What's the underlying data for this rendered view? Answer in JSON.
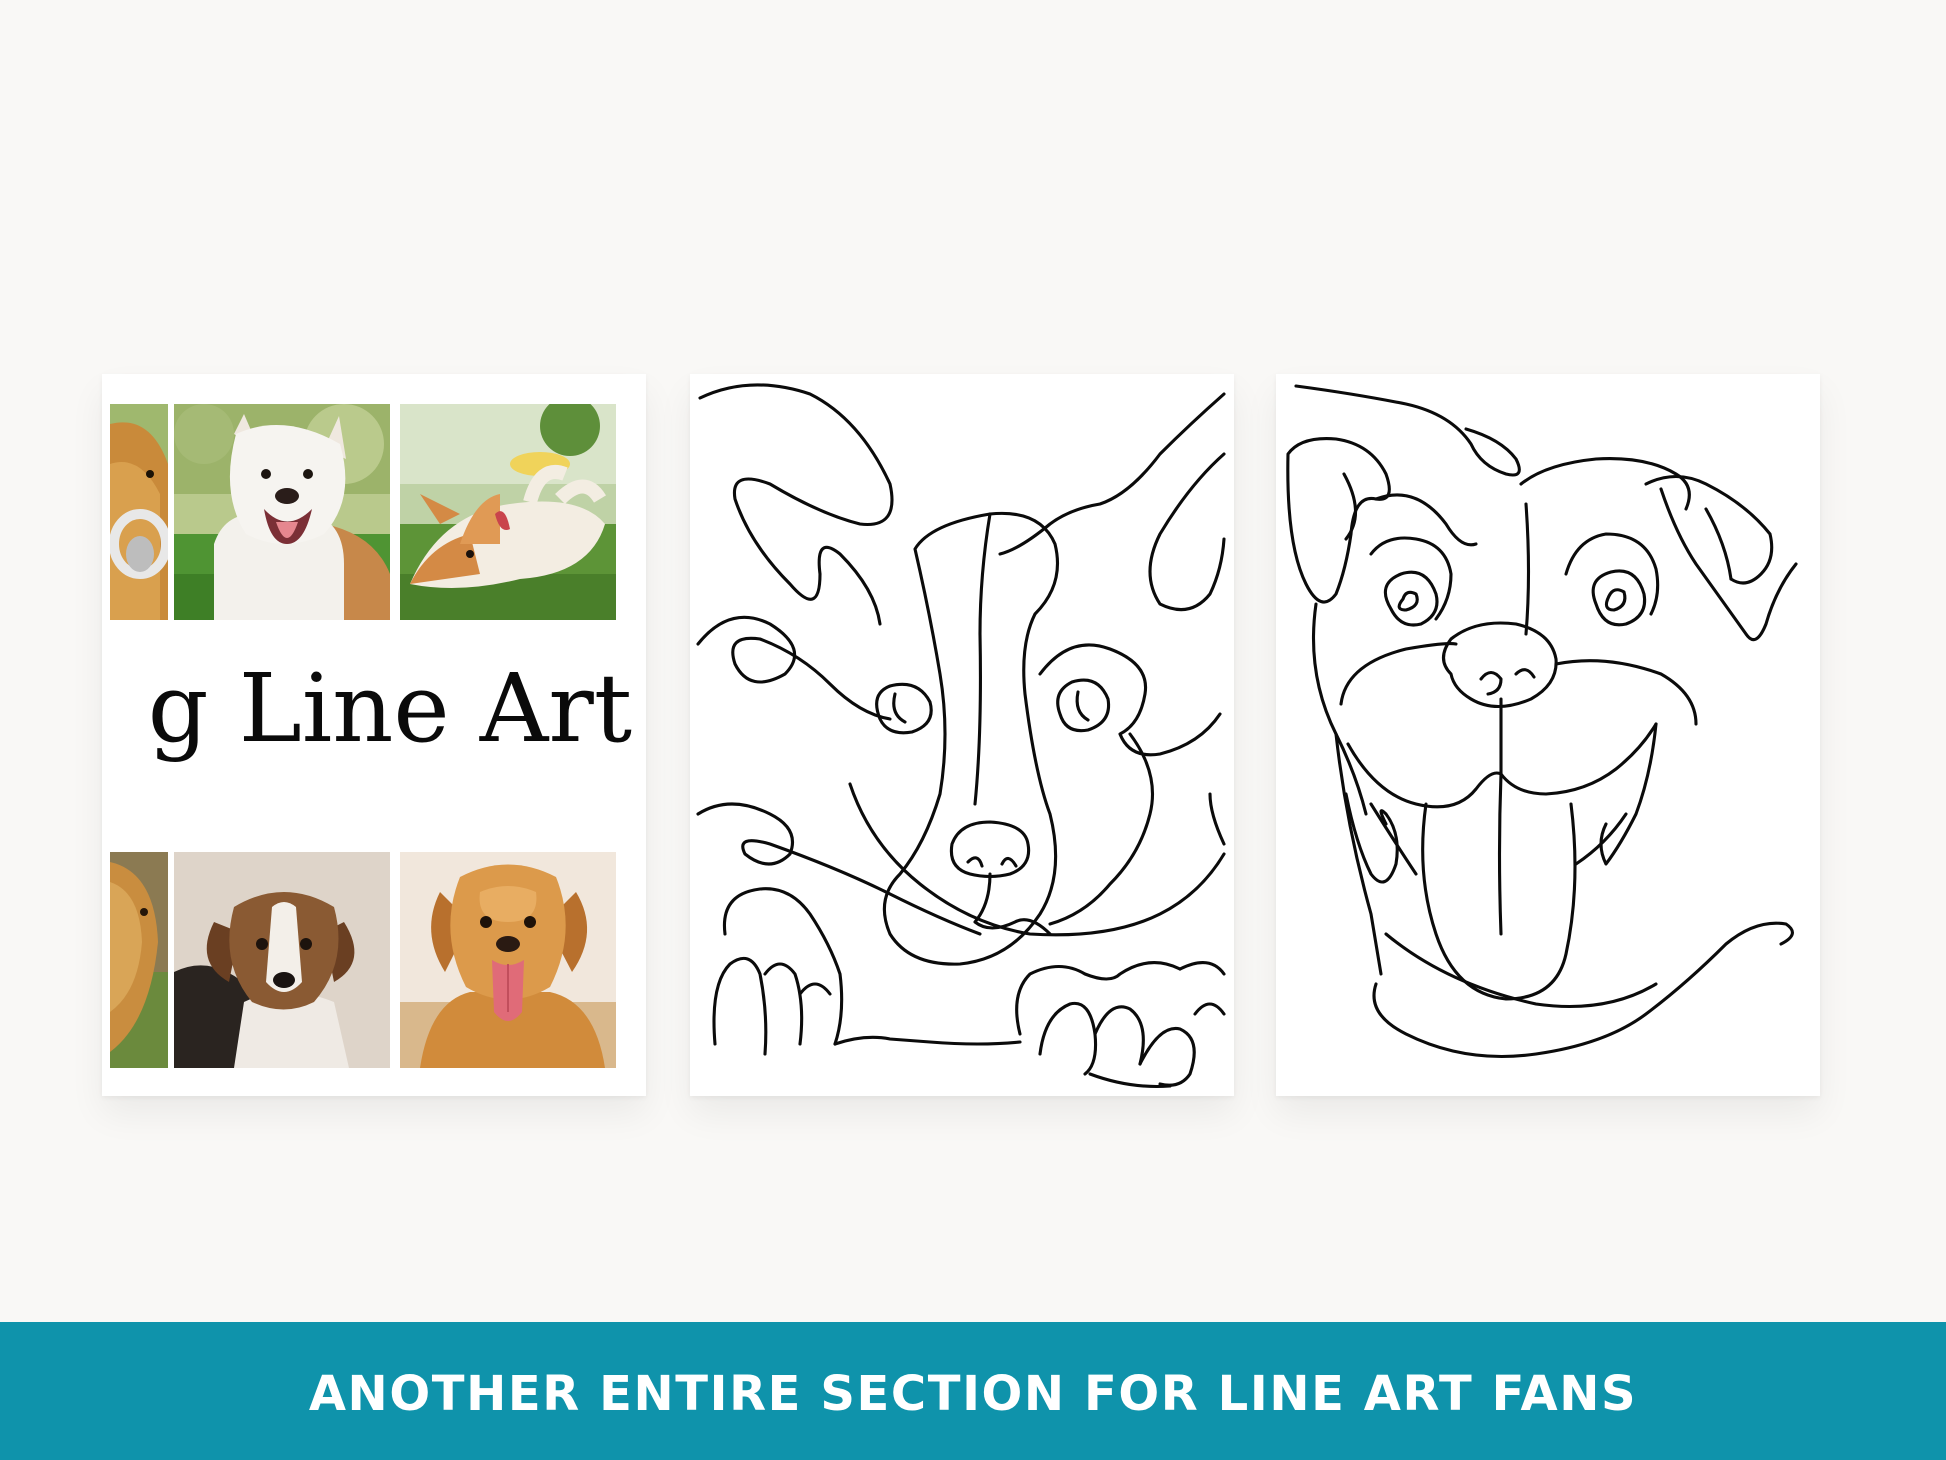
{
  "cover": {
    "title_fragment": "g Line Art",
    "photos": [
      {
        "icon": "golden-retriever-headphones-photo"
      },
      {
        "icon": "white-pitbull-grass-photo"
      },
      {
        "icon": "corgi-rolling-grass-photo"
      },
      {
        "icon": "golden-dog-partial-photo"
      },
      {
        "icon": "tricolor-puppy-photo"
      },
      {
        "icon": "golden-retriever-tongue-photo"
      }
    ]
  },
  "pages": [
    {
      "icon": "corgi-line-art"
    },
    {
      "icon": "pitbull-line-art"
    }
  ],
  "banner": {
    "text": "ANOTHER ENTIRE SECTION FOR LINE ART FANS",
    "color": "#0f93ab"
  },
  "colors": {
    "background": "#f9f8f6",
    "card": "#ffffff",
    "ink": "#0b0b0b"
  }
}
